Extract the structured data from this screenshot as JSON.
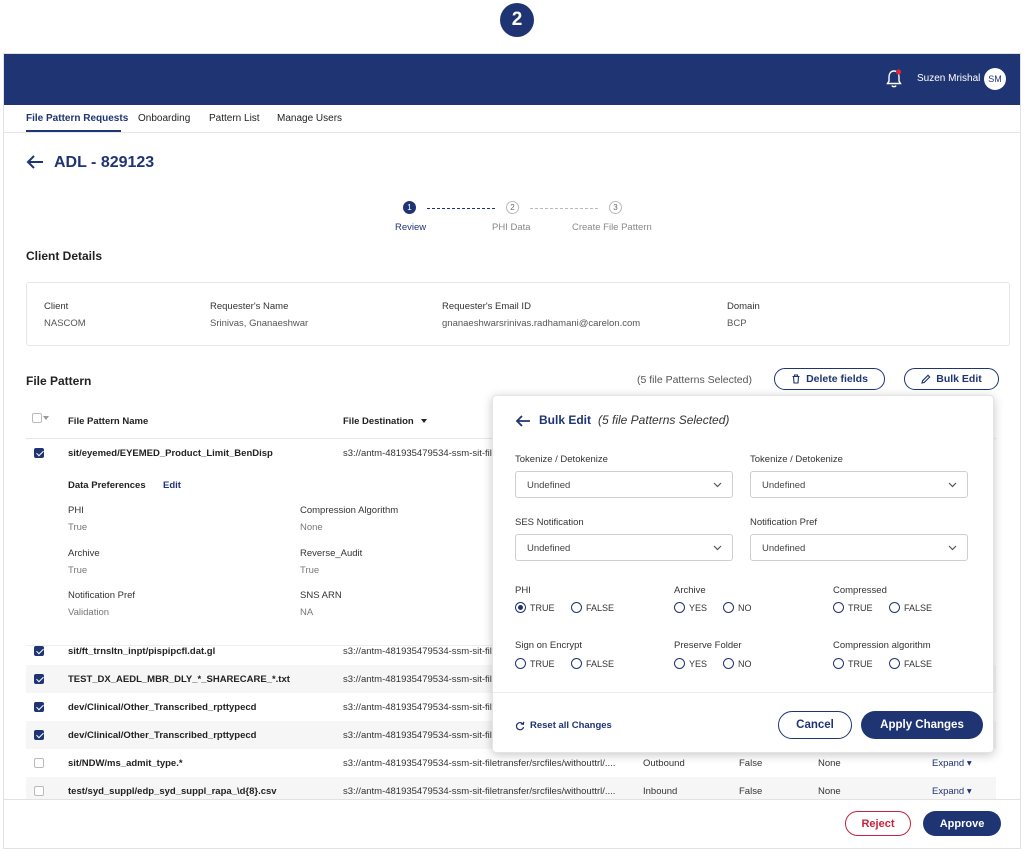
{
  "step_badge": "2",
  "header": {
    "user_name": "Suzen Mrishal",
    "avatar_initials": "SM",
    "brand_color": "#1f3473"
  },
  "tabs": [
    {
      "label": "File Pattern Requests",
      "active": true
    },
    {
      "label": "Onboarding",
      "active": false
    },
    {
      "label": "Pattern List",
      "active": false
    },
    {
      "label": "Manage Users",
      "active": false
    }
  ],
  "page_title": "ADL - 829123",
  "stepper": [
    {
      "num": "1",
      "label": "Review",
      "active": true
    },
    {
      "num": "2",
      "label": "PHI Data",
      "active": false
    },
    {
      "num": "3",
      "label": "Create File Pattern",
      "active": false
    }
  ],
  "client_details": {
    "title": "Client Details",
    "fields": [
      {
        "label": "Client",
        "value": "NASCOM"
      },
      {
        "label": "Requester's Name",
        "value": "Srinivas, Gnanaeshwar"
      },
      {
        "label": "Requester's  Email ID",
        "value": "gnanaeshwarsrinivas.radhamani@carelon.com"
      },
      {
        "label": "Domain",
        "value": "BCP"
      }
    ]
  },
  "file_pattern": {
    "title": "File Pattern",
    "selected_count": "(5 file Patterns Selected)",
    "delete_label": "Delete fields",
    "bulk_edit_label": "Bulk Edit",
    "columns": {
      "name": "File Pattern Name",
      "destination": "File Destination"
    },
    "expanded_row": {
      "name": "sit/eyemed/EYEMED_Product_Limit_BenDisp",
      "destination": "s3://antm-481935479534-ssm-sit-fil",
      "checked": true
    },
    "data_preferences": {
      "title": "Data Preferences",
      "edit_label": "Edit",
      "items": [
        {
          "label": "PHI",
          "value": "True"
        },
        {
          "label": "Compression Algorithm",
          "value": "None"
        },
        {
          "label": "Archive",
          "value": "True"
        },
        {
          "label": "Reverse_Audit",
          "value": "True"
        },
        {
          "label": "Notification Pref",
          "value": "Validation"
        },
        {
          "label": "SNS ARN",
          "value": "NA"
        }
      ]
    },
    "rows": [
      {
        "name": "sit/ft_trnsltn_inpt/pispipcfl.dat.gl",
        "destination": "s3://antm-481935479534-ssm-sit-fil",
        "checked": true,
        "bold": true
      },
      {
        "name": "TEST_DX_AEDL_MBR_DLY_*_SHARECARE_*.txt",
        "destination": "s3://antm-481935479534-ssm-sit-fil",
        "checked": true,
        "bold": true
      },
      {
        "name": "dev/Clinical/Other_Transcribed_rpttypecd",
        "destination": "s3://antm-481935479534-ssm-sit-fil",
        "checked": true,
        "bold": true
      },
      {
        "name": "dev/Clinical/Other_Transcribed_rpttypecd",
        "destination": "s3://antm-481935479534-ssm-sit-fil",
        "checked": true,
        "bold": true
      },
      {
        "name": "sit/NDW/ms_admit_type.*",
        "destination": "s3://antm-481935479534-ssm-sit-filetransfer/srcfiles/withouttrl/....",
        "direction": "Outbound",
        "flag": "False",
        "compression": "None",
        "expand": "Expand",
        "checked": false,
        "bold": false
      },
      {
        "name": "test/syd_suppl/edp_syd_suppl_rapa_\\d{8}.csv",
        "destination": "s3://antm-481935479534-ssm-sit-filetransfer/srcfiles/withouttrl/....",
        "direction": "Inbound",
        "flag": "False",
        "compression": "None",
        "expand": "Expand",
        "checked": false,
        "bold": false
      }
    ]
  },
  "bulk_edit": {
    "title": "Bulk Edit",
    "subtitle": "(5 file Patterns Selected)",
    "selects": [
      {
        "label": "Tokenize / Detokenize",
        "value": "Undefined"
      },
      {
        "label": "Tokenize / Detokenize",
        "value": "Undefined"
      },
      {
        "label": "SES Notification",
        "value": "Undefined"
      },
      {
        "label": "Notification Pref",
        "value": "Undefined"
      }
    ],
    "radio_groups": [
      {
        "label": "PHI",
        "options": [
          "TRUE",
          "FALSE"
        ],
        "selected": "TRUE"
      },
      {
        "label": "Archive",
        "options": [
          "YES",
          "NO"
        ],
        "selected": ""
      },
      {
        "label": "Compressed",
        "options": [
          "TRUE",
          "FALSE"
        ],
        "selected": ""
      },
      {
        "label": "Sign on Encrypt",
        "options": [
          "TRUE",
          "FALSE"
        ],
        "selected": ""
      },
      {
        "label": "Preserve Folder",
        "options": [
          "YES",
          "NO"
        ],
        "selected": ""
      },
      {
        "label": "Compression algorithm",
        "options": [
          "TRUE",
          "FALSE"
        ],
        "selected": ""
      }
    ],
    "reset_label": "Reset all Changes",
    "cancel_label": "Cancel",
    "apply_label": "Apply Changes"
  },
  "footer": {
    "reject_label": "Reject",
    "approve_label": "Approve",
    "reject_color": "#c8223f"
  }
}
